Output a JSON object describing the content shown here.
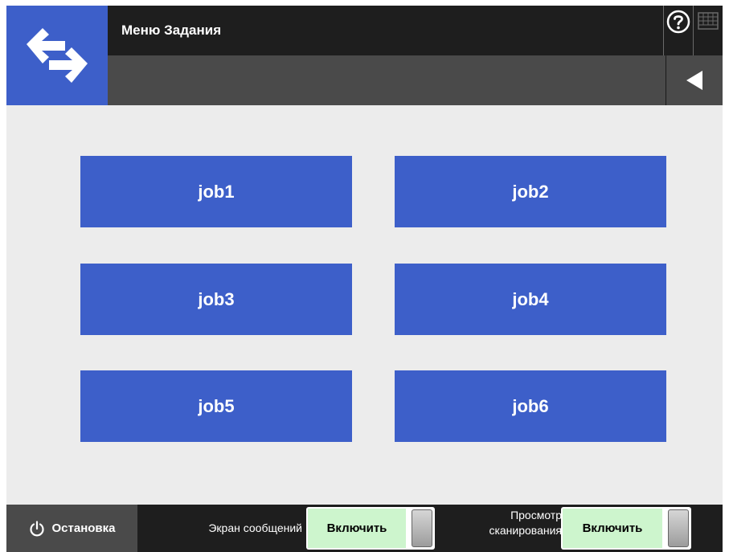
{
  "header": {
    "title": "Меню Задания"
  },
  "icons": {
    "logo": "switch-arrows-icon",
    "help": "help-icon",
    "keyboard": "keyboard-icon",
    "back": "back-triangle-icon",
    "power": "power-icon"
  },
  "jobs": [
    {
      "label": "job1"
    },
    {
      "label": "job2"
    },
    {
      "label": "job3"
    },
    {
      "label": "job4"
    },
    {
      "label": "job5"
    },
    {
      "label": "job6"
    }
  ],
  "footer": {
    "stop_label": "Остановка",
    "message_screen": {
      "label": "Экран сообщений",
      "toggle": "Включить"
    },
    "scan_preview": {
      "label_line1": "Просмотр",
      "label_line2": "сканирования",
      "toggle": "Включить"
    }
  },
  "colors": {
    "accent": "#3d5fc9",
    "topbar": "#1e1e1e",
    "subbar": "#4a4a4a",
    "content_bg": "#ececec",
    "toggle_on": "#cdf5cd"
  }
}
